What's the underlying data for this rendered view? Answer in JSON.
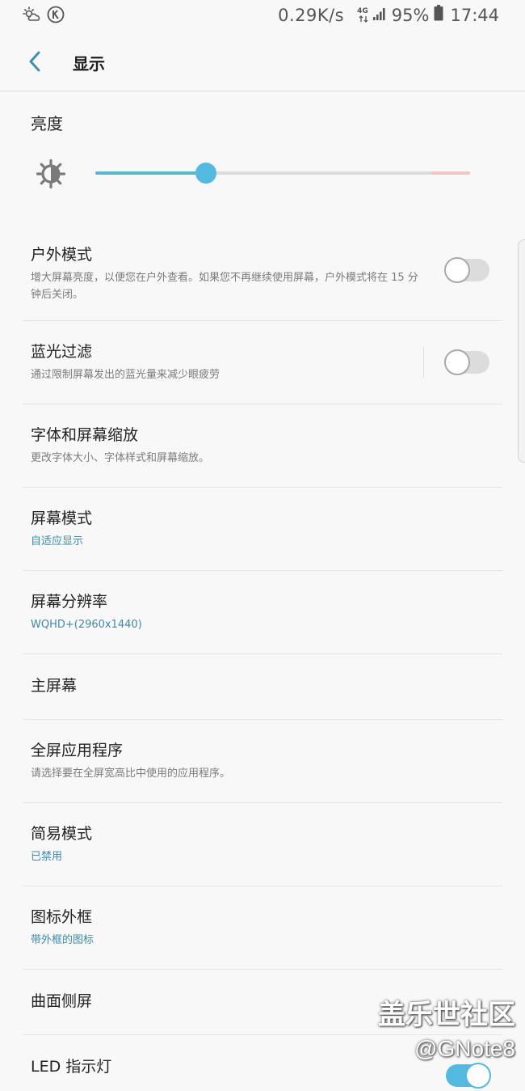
{
  "status_bar": {
    "speed": "0.29K/s",
    "network_type": "4G",
    "battery": "95%",
    "time": "17:44",
    "icons": [
      "weather-icon",
      "k-icon",
      "data-arrows-icon",
      "signal-icon",
      "battery-icon"
    ]
  },
  "header": {
    "title": "显示",
    "back_icon": "back-arrow-icon"
  },
  "brightness": {
    "label": "亮度",
    "level": 0.295,
    "icon": "brightness-sun-icon"
  },
  "settings": [
    {
      "id": "outdoor-mode",
      "title": "户外模式",
      "subtitle": "增大屏幕亮度，以便您在户外查看。如果您不再继续使用屏幕，户外模式将在 15 分钟后关闭。",
      "toggle": "off"
    },
    {
      "id": "blue-light-filter",
      "title": "蓝光过滤",
      "subtitle": "通过限制屏幕发出的蓝光量来减少眼疲劳",
      "toggle": "off"
    },
    {
      "id": "font-and-zoom",
      "title": "字体和屏幕缩放",
      "subtitle": "更改字体大小、字体样式和屏幕缩放。"
    },
    {
      "id": "screen-mode",
      "title": "屏幕模式",
      "subtitle": "自适应显示",
      "accent": true
    },
    {
      "id": "screen-resolution",
      "title": "屏幕分辨率",
      "subtitle": "WQHD+(2960x1440)",
      "accent": true
    },
    {
      "id": "home-screen",
      "title": "主屏幕"
    },
    {
      "id": "full-screen-apps",
      "title": "全屏应用程序",
      "subtitle": "请选择要在全屏宽高比中使用的应用程序。"
    },
    {
      "id": "easy-mode",
      "title": "简易模式",
      "subtitle": "已禁用",
      "accent": true
    },
    {
      "id": "icon-frames",
      "title": "图标外框",
      "subtitle": "带外框的图标",
      "accent": true
    },
    {
      "id": "edge-screen",
      "title": "曲面侧屏"
    },
    {
      "id": "led-indicator",
      "title": "LED 指示灯",
      "toggle": "on"
    }
  ],
  "watermark": {
    "line1": "盖乐世社区",
    "line2": "@GNote8"
  },
  "colors": {
    "accent": "#53b9df",
    "subtitle_accent": "#3e8aa8",
    "background": "#f8f8f8"
  }
}
